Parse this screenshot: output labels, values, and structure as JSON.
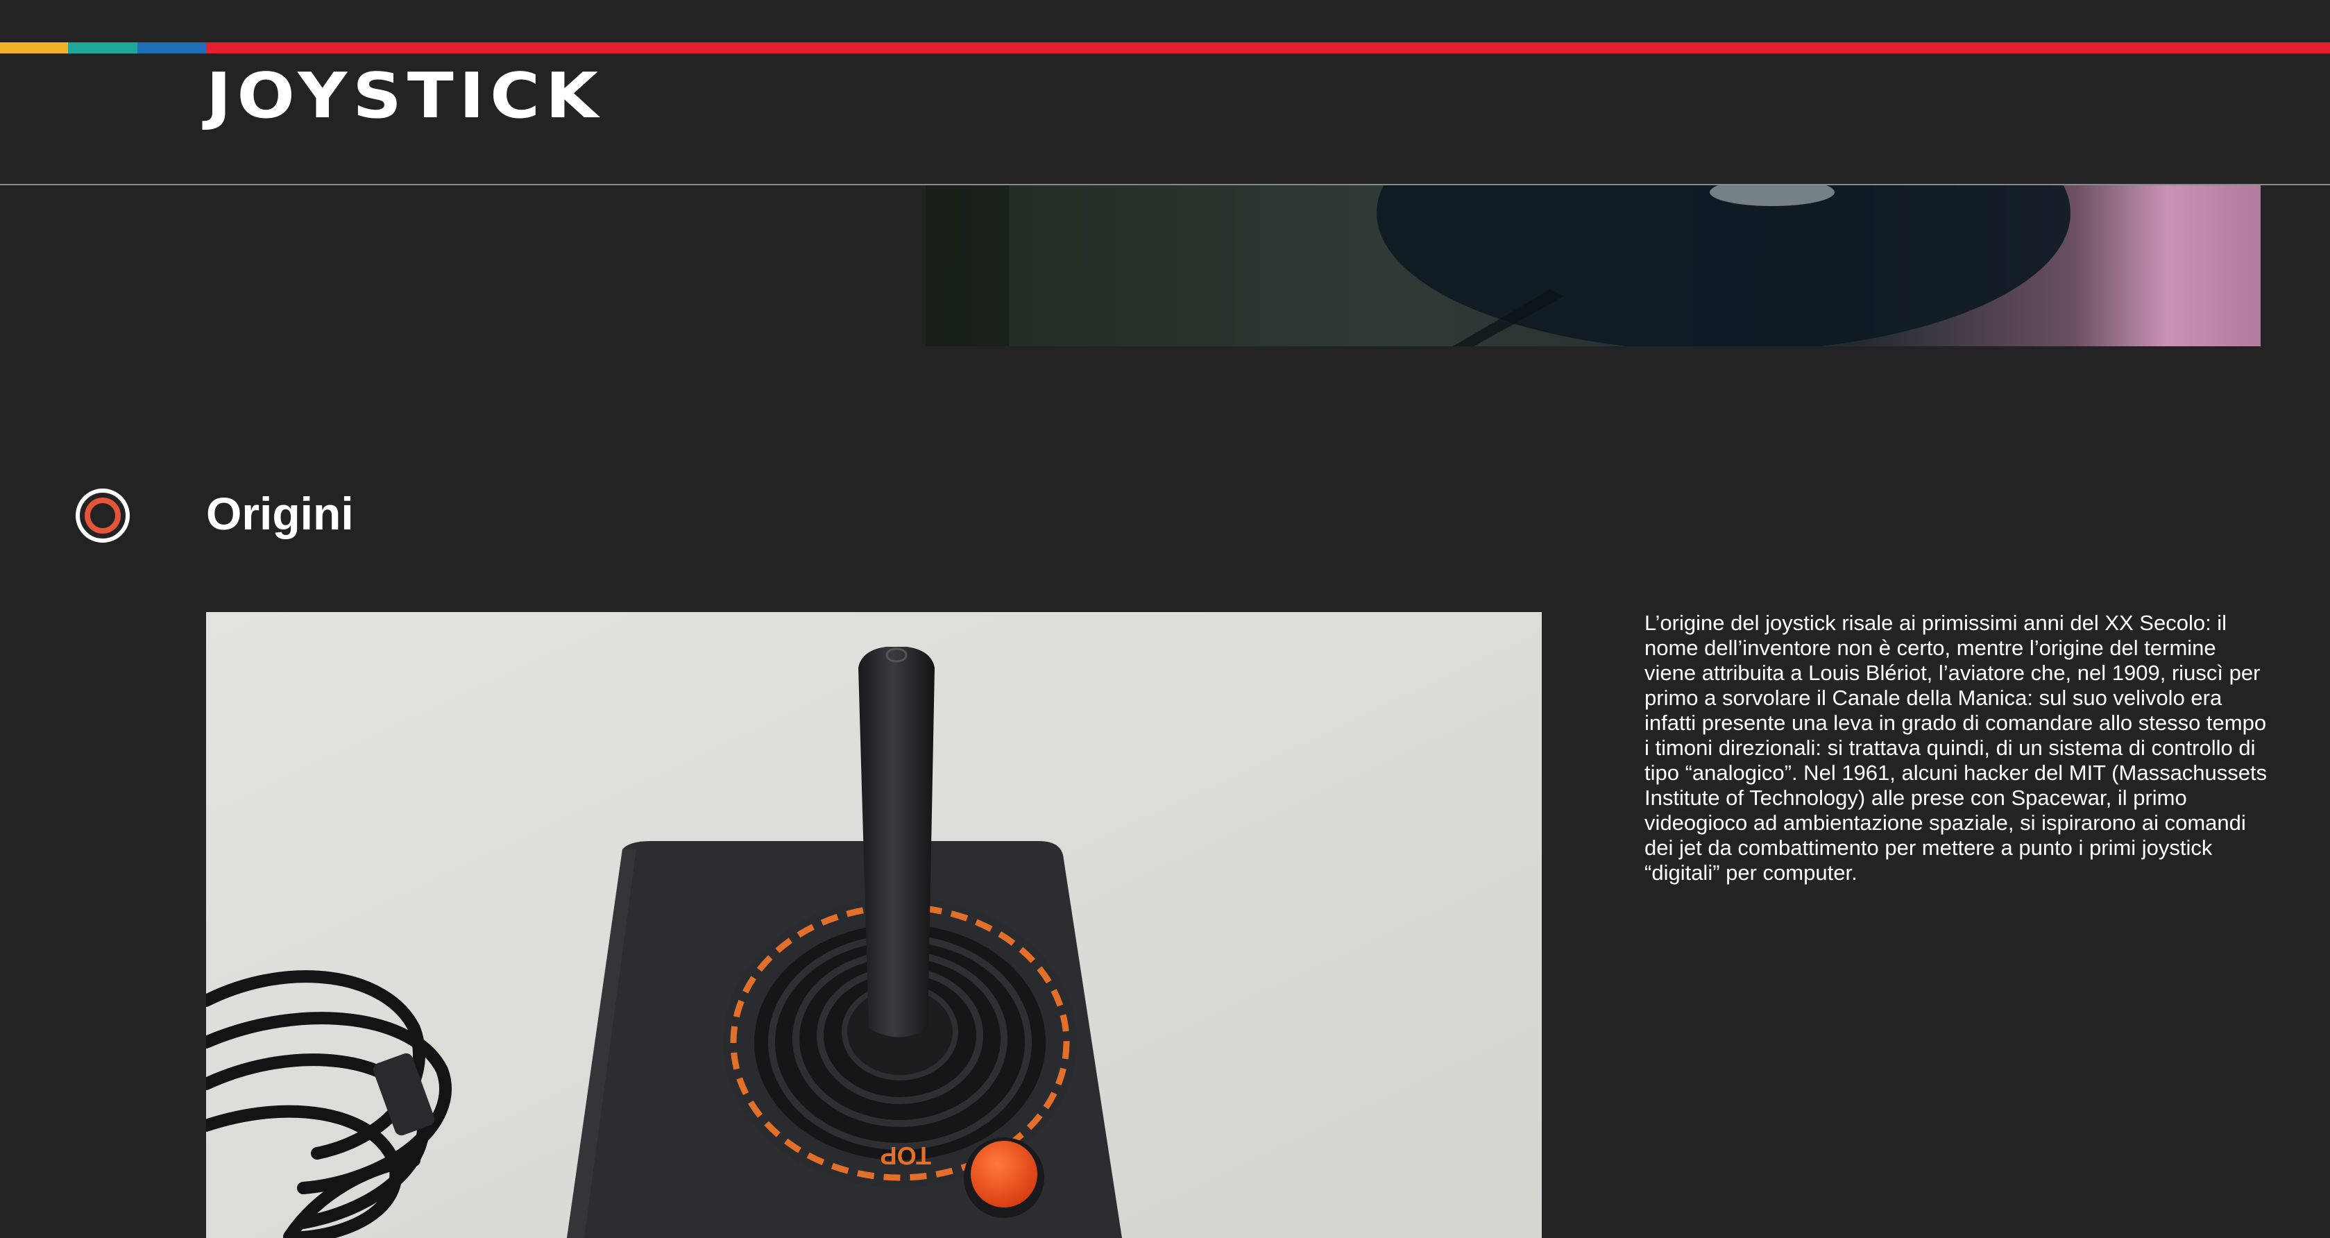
{
  "header": {
    "brand": "JOYSTICK",
    "color_strip": [
      "#f3b228",
      "#1fa89a",
      "#1e6fb8",
      "#e5202e"
    ]
  },
  "hero": {
    "icon": "video-still-image"
  },
  "section": {
    "icon": "record-circle-icon",
    "icon_ring_color": "#ffffff",
    "icon_dot_color": "#e5553a",
    "title": "Origini",
    "photo": "atari-joystick-photo",
    "body": "L’origine del joystick risale ai primissimi anni del XX Secolo: il nome dell’inventore non è certo, mentre l’origine del termine viene attribuita a Louis Blériot, l’aviatore che, nel 1909, riuscì per primo a sorvolare il Canale della Manica: sul suo velivolo era infatti presente una leva in grado di comandare allo stesso tempo i timoni direzionali: si trattava quindi, di un sistema di controllo di tipo “analogico”. Nel 1961, alcuni hacker del MIT (Massachussets Institute of Technology) alle prese con Spacewar, il primo videogioco ad ambientazione spaziale, si ispirarono ai comandi dei jet da combattimento per mettere a punto i primi joystick “digitali” per computer."
  }
}
